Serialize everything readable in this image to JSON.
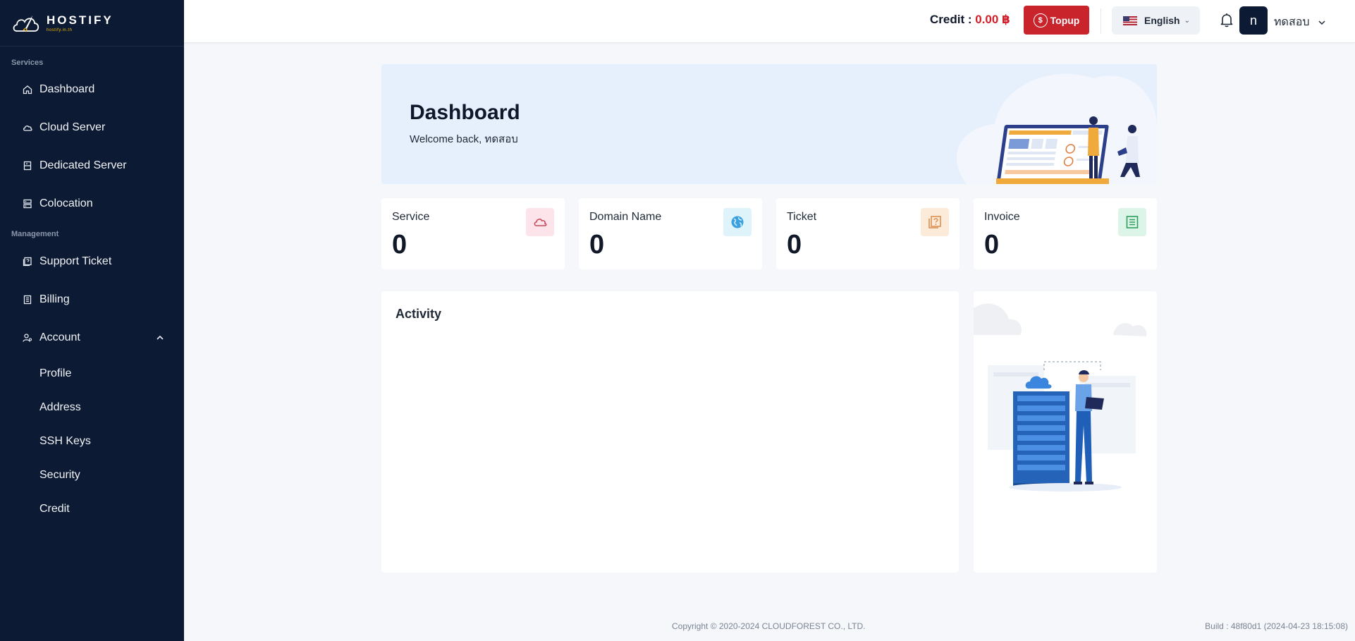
{
  "brand": {
    "name": "HOSTIFY",
    "sub": "hostify.in.th"
  },
  "sidebar": {
    "services_label": "Services",
    "management_label": "Management",
    "items": {
      "dashboard": "Dashboard",
      "cloud_server": "Cloud Server",
      "dedicated_server": "Dedicated Server",
      "colocation": "Colocation",
      "support_ticket": "Support Ticket",
      "billing": "Billing",
      "account": "Account"
    },
    "account_sub": {
      "profile": "Profile",
      "address": "Address",
      "ssh_keys": "SSH Keys",
      "security": "Security",
      "credit": "Credit"
    }
  },
  "header": {
    "credit_label": "Credit : ",
    "credit_amount": "0.00 ฿",
    "topup_label": "Topup",
    "topup_symbol": "$",
    "language": "English",
    "avatar_initial": "n",
    "username": "ทดสอบ"
  },
  "hero": {
    "title": "Dashboard",
    "welcome": "Welcome back, ทดสอบ"
  },
  "stats": {
    "service": {
      "label": "Service",
      "value": "0"
    },
    "domain": {
      "label": "Domain Name",
      "value": "0"
    },
    "ticket": {
      "label": "Ticket",
      "value": "0"
    },
    "invoice": {
      "label": "Invoice",
      "value": "0"
    }
  },
  "activity": {
    "title": "Activity"
  },
  "footer": {
    "copyright": "Copyright © 2020-2024 CLOUDFOREST CO., LTD.",
    "build": "Build : 48f80d1 (2024-04-23 18:15:08)"
  },
  "colors": {
    "sidebar_bg": "#0c1a33",
    "accent_red": "#c9232c",
    "hero_bg": "#e6f0fd"
  },
  "icons": {
    "nav": [
      "home-icon",
      "cloud-icon",
      "server-icon",
      "rack-icon",
      "ticket-icon",
      "billing-icon",
      "account-icon"
    ],
    "header": [
      "coin-icon",
      "us-flag-icon",
      "bell-icon",
      "chevron-down-icon"
    ],
    "stats": [
      "cloud-icon",
      "globe-icon",
      "help-ticket-icon",
      "invoice-icon"
    ]
  }
}
